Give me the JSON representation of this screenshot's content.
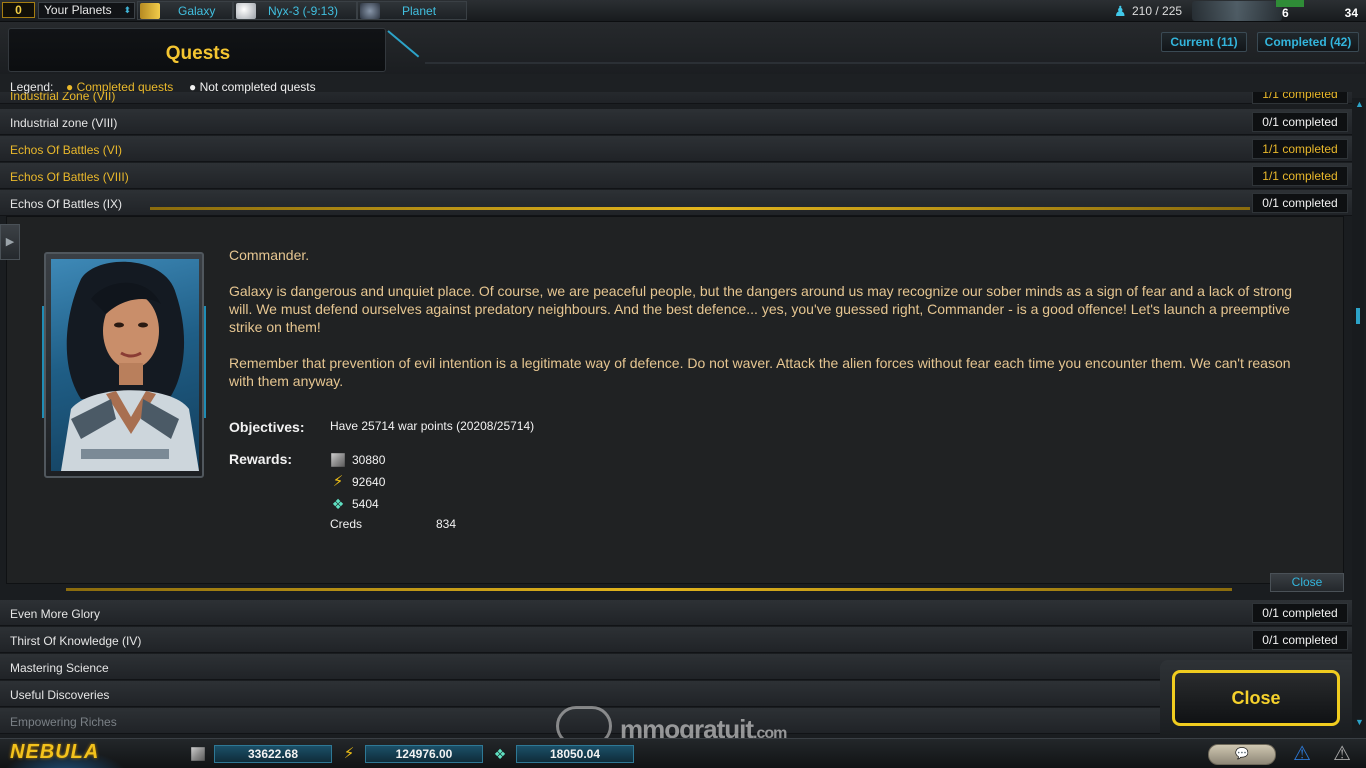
{
  "topbar": {
    "count": "0",
    "planets_select": "Your Planets",
    "tabs": [
      {
        "label": "Galaxy",
        "icon": "galaxy-icon",
        "color": "#f1cc4a"
      },
      {
        "label": "Nyx-3 (-9:13)",
        "icon": "planet-icon",
        "color": "#e4e4e4"
      },
      {
        "label": "Planet",
        "icon": "planet-orbit-icon",
        "color": "#8795a8"
      }
    ],
    "population": "210 / 225",
    "ships": "6",
    "level": "34"
  },
  "header": {
    "title": "Quests",
    "current_tab": "Current (11)",
    "completed_tab": "Completed (42)"
  },
  "legend": {
    "label": "Legend:",
    "completed": "● Completed quests",
    "not_completed": "● Not completed quests"
  },
  "quests_top": [
    {
      "name": "Industrial Zone (VII)",
      "status": "1/1 completed",
      "done": true
    },
    {
      "name": "Industrial zone (VIII)",
      "status": "0/1 completed",
      "done": false
    },
    {
      "name": "Echos Of Battles (VI)",
      "status": "1/1 completed",
      "done": true
    },
    {
      "name": "Echos Of Battles (VIII)",
      "status": "1/1 completed",
      "done": true
    },
    {
      "name": "Echos Of Battles (IX)",
      "status": "0/1 completed",
      "done": false
    }
  ],
  "detail": {
    "greeting": "Commander.",
    "paragraph1": "Galaxy is dangerous and unquiet place. Of course, we are peaceful people, but the dangers around us may recognize our sober minds as a sign of fear and a lack of strong will. We must defend ourselves against predatory neighbours. And the best defence... yes, you've guessed right, Commander - is a good offence! Let's launch a preemptive strike on them!",
    "paragraph2": "Remember that prevention of evil intention is a legitimate way of defence. Do not waver. Attack the alien forces without fear each time you encounter them. We can't reason with them anyway.",
    "objectives_label": "Objectives:",
    "objective": "Have 25714 war points (20208/25714)",
    "rewards_label": "Rewards:",
    "rewards": [
      {
        "icon": "metal-cube-icon",
        "value": "30880"
      },
      {
        "icon": "energy-bolt-icon",
        "value": "92640"
      },
      {
        "icon": "crystal-icon",
        "value": "5404"
      }
    ],
    "creds_label": "Creds",
    "creds_value": "834",
    "close_small": "Close"
  },
  "quests_bottom": [
    {
      "name": "Even More Glory",
      "status": "0/1 completed",
      "done": false
    },
    {
      "name": "Thirst Of Knowledge (IV)",
      "status": "0/1 completed",
      "done": false
    },
    {
      "name": "Mastering Science",
      "status": "",
      "done": false
    },
    {
      "name": "Useful Discoveries",
      "status": "",
      "done": false
    },
    {
      "name": "Empowering Riches",
      "status": "",
      "done": false
    }
  ],
  "close_button": "Close",
  "watermark": {
    "brand": "mmogratuit",
    "suffix": ".com"
  },
  "bottombar": {
    "logo": "NEBULA",
    "metal": "33622.68",
    "energy": "124976.00",
    "crystal": "18050.04",
    "chat_icon": "chat-bubble-icon",
    "alert_blue": "⚠",
    "alert_grey": "⚠"
  },
  "colors": {
    "accent_gold": "#f4c531",
    "accent_cyan": "#33b5dc",
    "completed": "#e9b82b",
    "story_text": "#e6c691"
  }
}
